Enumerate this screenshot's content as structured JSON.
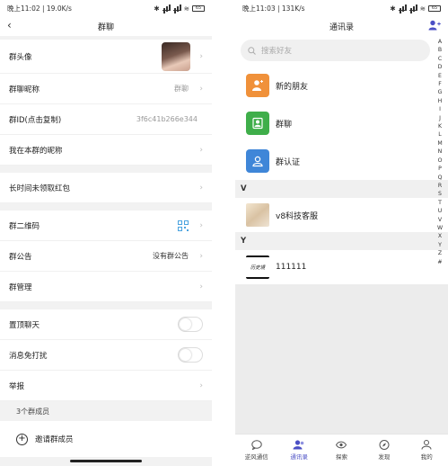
{
  "left": {
    "status": {
      "time": "晚上11:02 | 19.0K/s",
      "battery": "65"
    },
    "title": "群聊",
    "rows": {
      "group_avatar": "群头像",
      "group_nickname_label": "群聊昵称",
      "group_nickname_value": "群聊",
      "group_id_label": "群ID(点击复制)",
      "group_id_value": "3f6c41b266e344",
      "my_nickname": "我在本群的昵称",
      "unclaimed_red_packet": "长时间未领取红包",
      "qr_code": "群二维码",
      "announcement_label": "群公告",
      "announcement_value": "没有群公告",
      "management": "群管理",
      "pin_chat": "置顶聊天",
      "mute": "消息免打扰",
      "report": "举报"
    },
    "members_count": "3个群成员",
    "invite": "邀请群成员"
  },
  "right": {
    "status": {
      "time": "晚上11:03 | 131K/s",
      "battery": "65"
    },
    "title": "通讯录",
    "search_placeholder": "搜索好友",
    "entries": [
      "新的朋友",
      "群聊",
      "群认证"
    ],
    "entry_colors": [
      "#f0913a",
      "#3fae4a",
      "#3f86d8"
    ],
    "sections": [
      {
        "letter": "V",
        "contact": "v8科技客服"
      },
      {
        "letter": "Y",
        "contact": "111111"
      }
    ],
    "contact_logo_text": "历史境",
    "index": [
      "A",
      "B",
      "C",
      "D",
      "E",
      "F",
      "G",
      "H",
      "I",
      "J",
      "K",
      "L",
      "M",
      "N",
      "O",
      "P",
      "Q",
      "R",
      "S",
      "T",
      "U",
      "V",
      "W",
      "X",
      "Y",
      "Z",
      "#"
    ],
    "tabs": [
      "逆风通信",
      "通讯录",
      "探索",
      "发现",
      "我的"
    ],
    "active_tab": "通讯录",
    "accent": "#4b4fc5"
  }
}
